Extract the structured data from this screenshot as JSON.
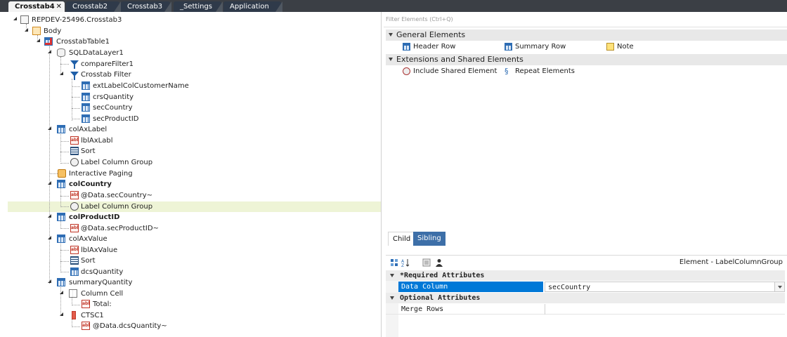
{
  "tabs": [
    {
      "label": "Crosstab4",
      "close": "✕",
      "active": true
    },
    {
      "label": "Crosstab2",
      "active": false
    },
    {
      "label": "Crosstab3",
      "active": false
    },
    {
      "label": "_Settings",
      "active": false
    },
    {
      "label": "Application",
      "active": false
    }
  ],
  "tree": {
    "root": "REPDEV-25496.Crosstab3",
    "body": "Body",
    "crosstab_table": "CrosstabTable1",
    "sql_data_layer": "SQLDataLayer1",
    "compare_filter": "compareFilter1",
    "crosstab_filter": "Crosstab Filter",
    "ext_label": "extLabelColCustomerName",
    "crs_quantity": "crsQuantity",
    "sec_country": "secCountry",
    "sec_product_id": "secProductID",
    "col_ax_label": "colAxLabel",
    "lbl_ax_labl": "lblAxLabl",
    "sort1": "Sort",
    "label_column_group1": "Label Column Group",
    "interactive_paging": "Interactive Paging",
    "col_country": "colCountry",
    "data_sec_country": "@Data.secCountry~",
    "label_column_group2": "Label Column Group",
    "col_product_id": "colProductID",
    "data_sec_product_id": "@Data.secProductID~",
    "col_ax_value": "colAxValue",
    "lbl_ax_value": "lblAxValue",
    "sort2": "Sort",
    "dcs_quantity": "dcsQuantity",
    "summary_quantity": "summaryQuantity",
    "column_cell": "Column Cell",
    "total": "Total:",
    "ctsc1": "CTSC1",
    "data_dcs_quantity": "@Data.dcsQuantity~"
  },
  "right": {
    "filter_placeholder": "Filter Elements (Ctrl+Q)",
    "general_section": "General Elements",
    "general_items": [
      "Header Row",
      "Summary Row",
      "Note"
    ],
    "extensions_section": "Extensions and Shared Elements",
    "extension_items": [
      "Include Shared Element",
      "Repeat Elements"
    ],
    "subtabs": {
      "child": "Child",
      "sibling": "Sibling"
    },
    "element_name": "Element - LabelColumnGroup",
    "required_header": "*Required Attributes",
    "data_column_label": "Data Column",
    "data_column_value": "secCountry",
    "optional_header": "Optional Attributes",
    "merge_rows_label": "Merge Rows",
    "merge_rows_value": ""
  },
  "colors": {
    "tabstrip": "#3b3f45",
    "highlight_row": "#eef4d6",
    "selected_attr": "#0078d7",
    "sibling_tab": "#3d6fa8"
  }
}
